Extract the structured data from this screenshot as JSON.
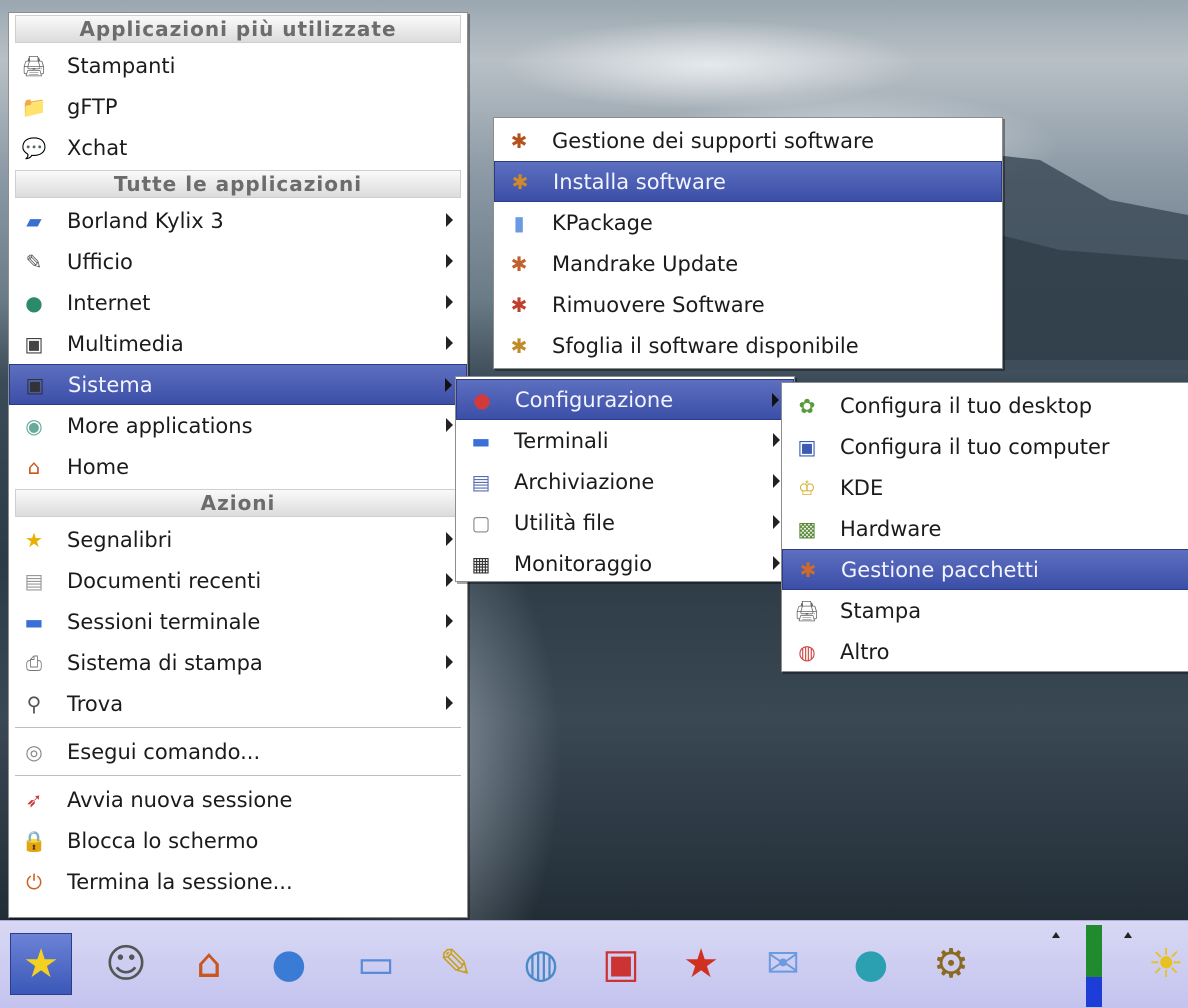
{
  "main_menu": {
    "section_frequent": "Applicazioni più utilizzate",
    "frequent_items": [
      {
        "label": "Stampanti",
        "icon": "printer-icon"
      },
      {
        "label": "gFTP",
        "icon": "ftp-icon"
      },
      {
        "label": "Xchat",
        "icon": "chat-icon"
      }
    ],
    "section_all": "Tutte le applicazioni",
    "all_items": [
      {
        "label": "Borland Kylix 3",
        "icon": "kylix-icon",
        "submenu": true
      },
      {
        "label": "Ufficio",
        "icon": "office-icon",
        "submenu": true
      },
      {
        "label": "Internet",
        "icon": "globe-icon",
        "submenu": true
      },
      {
        "label": "Multimedia",
        "icon": "multimedia-icon",
        "submenu": true
      },
      {
        "label": "Sistema",
        "icon": "system-icon",
        "submenu": true,
        "selected": true
      },
      {
        "label": "More applications",
        "icon": "more-apps-icon",
        "submenu": true
      },
      {
        "label": "Home",
        "icon": "home-icon",
        "submenu": false
      }
    ],
    "section_actions": "Azioni",
    "action_items": [
      {
        "label": "Segnalibri",
        "icon": "bookmark-star-icon",
        "submenu": true
      },
      {
        "label": "Documenti recenti",
        "icon": "document-icon",
        "submenu": true
      },
      {
        "label": "Sessioni terminale",
        "icon": "terminal-icon",
        "submenu": true
      },
      {
        "label": "Sistema di stampa",
        "icon": "print-system-icon",
        "submenu": true
      },
      {
        "label": "Trova",
        "icon": "search-icon",
        "submenu": true
      }
    ],
    "run_items": [
      {
        "label": "Esegui comando...",
        "icon": "run-command-icon"
      }
    ],
    "session_items": [
      {
        "label": "Avvia nuova sessione",
        "icon": "rocket-icon"
      },
      {
        "label": "Blocca lo schermo",
        "icon": "lock-screen-icon"
      },
      {
        "label": "Termina la sessione...",
        "icon": "logout-icon"
      }
    ]
  },
  "software_menu": {
    "items": [
      {
        "label": "Gestione dei supporti software",
        "icon": "software-media-icon"
      },
      {
        "label": "Installa software",
        "icon": "install-software-icon",
        "selected": true
      },
      {
        "label": "KPackage",
        "icon": "kpackage-icon"
      },
      {
        "label": "Mandrake Update",
        "icon": "update-icon"
      },
      {
        "label": "Rimuovere Software",
        "icon": "remove-software-icon"
      },
      {
        "label": "Sfoglia il software disponibile",
        "icon": "browse-software-icon"
      }
    ]
  },
  "sistema_menu": {
    "items": [
      {
        "label": "Configurazione",
        "icon": "configuration-icon",
        "submenu": true,
        "selected": true
      },
      {
        "label": "Terminali",
        "icon": "terminal-icon",
        "submenu": true
      },
      {
        "label": "Archiviazione",
        "icon": "archive-icon",
        "submenu": true
      },
      {
        "label": "Utilità file",
        "icon": "file-utility-icon",
        "submenu": true
      },
      {
        "label": "Monitoraggio",
        "icon": "monitor-icon",
        "submenu": true
      }
    ]
  },
  "config_menu": {
    "items": [
      {
        "label": "Configura il tuo desktop",
        "icon": "desktop-config-icon"
      },
      {
        "label": "Configura il tuo computer",
        "icon": "computer-config-icon"
      },
      {
        "label": "KDE",
        "icon": "kde-icon"
      },
      {
        "label": "Hardware",
        "icon": "hardware-icon"
      },
      {
        "label": "Gestione pacchetti",
        "icon": "package-manager-icon",
        "selected": true
      },
      {
        "label": "Stampa",
        "icon": "printer-icon"
      },
      {
        "label": "Altro",
        "icon": "other-icon"
      }
    ]
  },
  "taskbar": {
    "buttons": [
      {
        "icon": "star-menu-icon",
        "active": true
      },
      {
        "icon": "user-tools-icon"
      },
      {
        "icon": "home-icon"
      },
      {
        "icon": "blue-drive-icon"
      },
      {
        "icon": "window-icon"
      },
      {
        "icon": "text-editor-icon"
      },
      {
        "icon": "network-globe-icon"
      },
      {
        "icon": "computer-monitor-icon"
      },
      {
        "icon": "red-star-icon"
      },
      {
        "icon": "mail-icon"
      },
      {
        "icon": "earth-icon"
      },
      {
        "icon": "gear-circle-icon"
      },
      {
        "icon": "weather-sun-icon"
      }
    ]
  },
  "colors": {
    "selection": "#3c4fa8",
    "taskbar": "#c9c8f4"
  }
}
